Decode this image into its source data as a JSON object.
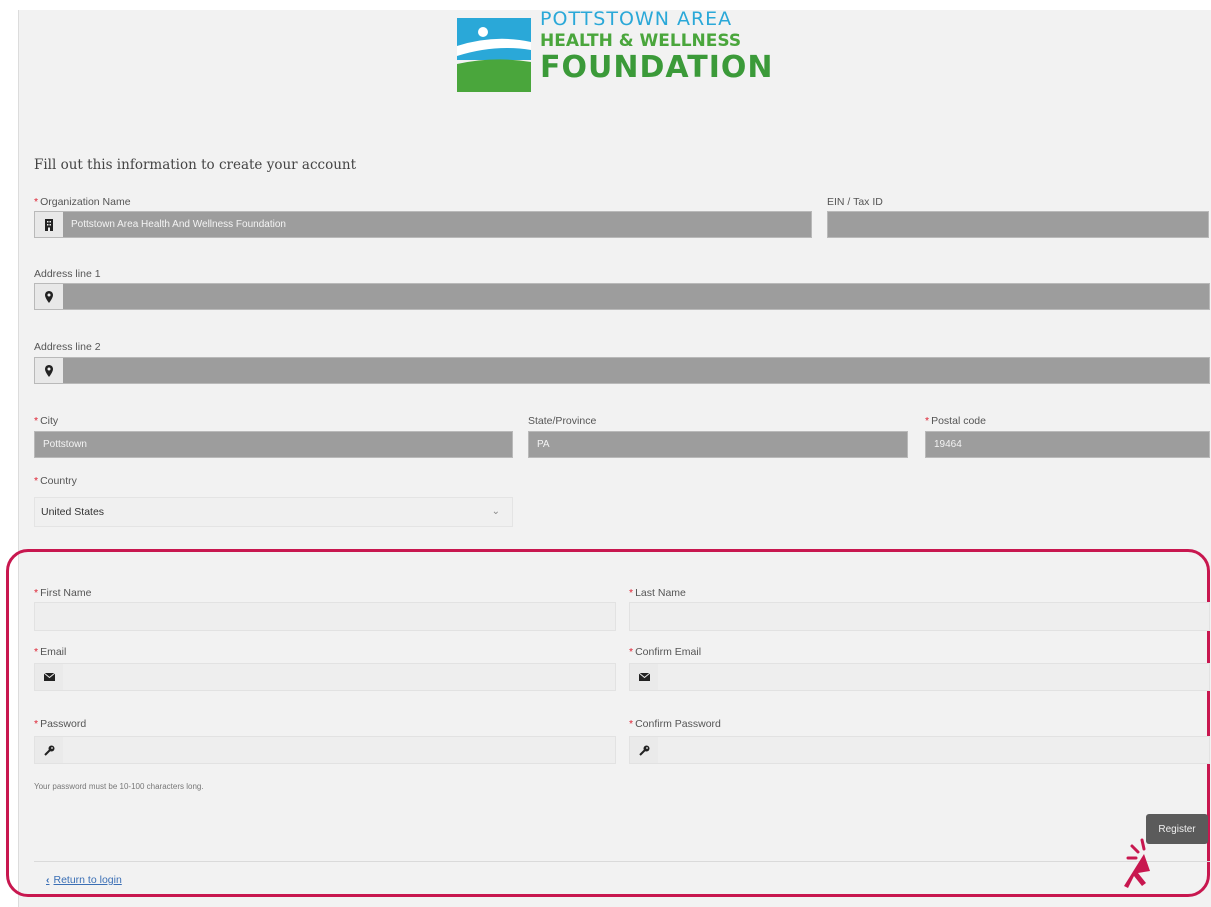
{
  "logo": {
    "line1": "POTTSTOWN AREA",
    "line2": "HEALTH & WELLNESS",
    "line3": "FOUNDATION"
  },
  "intro": "Fill out this information to create your account",
  "org": {
    "label": "Organization Name",
    "value": "Pottstown Area Health And Wellness Foundation",
    "icon": "building-icon"
  },
  "ein": {
    "label": "EIN / Tax ID",
    "value": ""
  },
  "address1": {
    "label": "Address line 1",
    "value": "",
    "icon": "map-pin-icon"
  },
  "address2": {
    "label": "Address line 2",
    "value": "",
    "icon": "map-pin-icon"
  },
  "city": {
    "label": "City",
    "value": "Pottstown"
  },
  "state": {
    "label": "State/Province",
    "value": "PA"
  },
  "postal": {
    "label": "Postal code",
    "value": "19464"
  },
  "country": {
    "label": "Country",
    "value": "United States"
  },
  "first_name": {
    "label": "First Name",
    "value": ""
  },
  "last_name": {
    "label": "Last Name",
    "value": ""
  },
  "email": {
    "label": "Email",
    "value": "",
    "icon": "envelope-icon"
  },
  "confirm_email": {
    "label": "Confirm Email",
    "value": "",
    "icon": "envelope-icon"
  },
  "password": {
    "label": "Password",
    "value": "",
    "icon": "key-icon"
  },
  "confirm_password": {
    "label": "Confirm Password",
    "value": "",
    "icon": "key-icon"
  },
  "password_hint": "Your password must be 10-100 characters long.",
  "register_label": "Register",
  "return_label": "Return to login",
  "required_mark": "*",
  "colors": {
    "highlight": "#c8174f",
    "logo_blue": "#2aa8d8",
    "logo_green": "#3b9a39",
    "link": "#3b6fb5"
  }
}
